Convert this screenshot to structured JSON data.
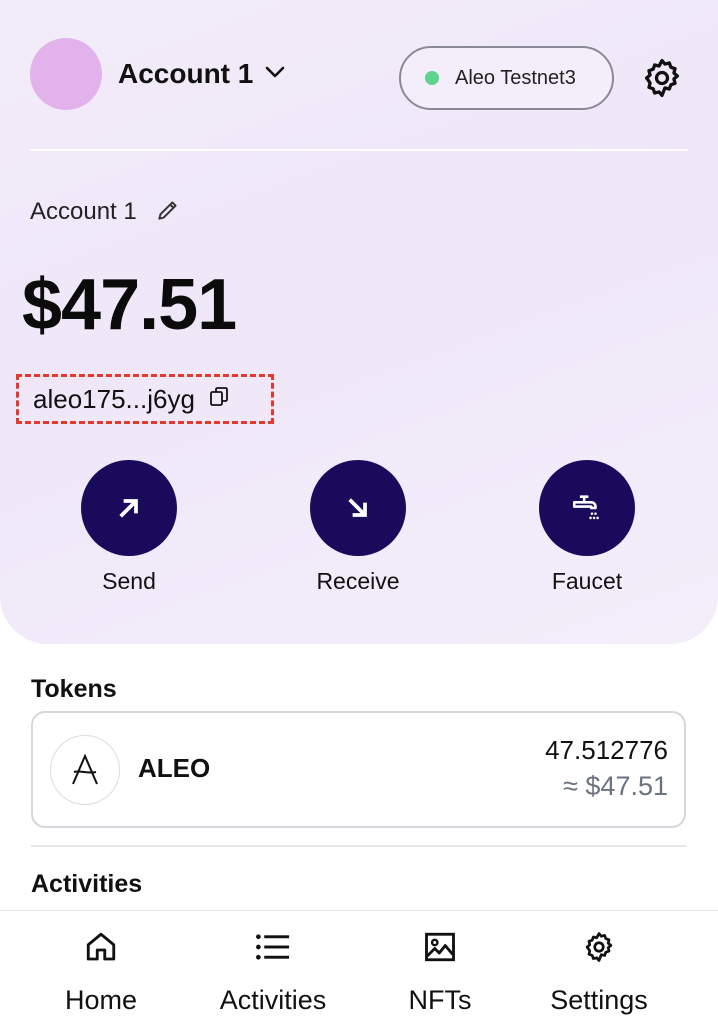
{
  "header": {
    "account_name": "Account 1",
    "network": "Aleo Testnet3",
    "network_status_color": "#5fd38d"
  },
  "wallet": {
    "account_label": "Account 1",
    "balance": "$47.51",
    "address": "aleo175...j6yg"
  },
  "actions": [
    {
      "label": "Send",
      "icon": "arrow-up-right-icon"
    },
    {
      "label": "Receive",
      "icon": "arrow-down-right-icon"
    },
    {
      "label": "Faucet",
      "icon": "faucet-icon"
    }
  ],
  "tokens": {
    "title": "Tokens",
    "items": [
      {
        "symbol": "ALEO",
        "amount": "47.512776",
        "usd_value": "≈ $47.51",
        "icon": "aleo-logo-icon"
      }
    ]
  },
  "activities": {
    "title": "Activities"
  },
  "nav": [
    {
      "label": "Home",
      "icon": "home-icon"
    },
    {
      "label": "Activities",
      "icon": "list-icon"
    },
    {
      "label": "NFTs",
      "icon": "image-icon"
    },
    {
      "label": "Settings",
      "icon": "gear-icon"
    }
  ],
  "colors": {
    "accent": "#1a0a5c",
    "avatar": "#e2b2ec",
    "highlight_border": "#e23a2c"
  }
}
